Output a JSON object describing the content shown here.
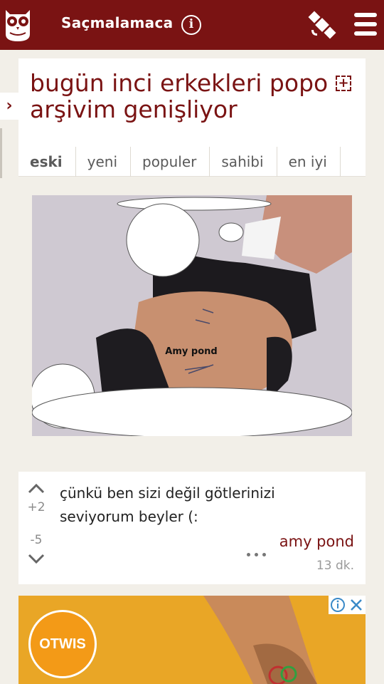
{
  "header": {
    "site_name": "Saçmalamaca",
    "info_label": "i"
  },
  "topic": {
    "title": "bugün inci erkekleri popo arşivim genişliyor",
    "follow_label": "+",
    "tabs": [
      "eski",
      "yeni",
      "populer",
      "sahibi",
      "en iyi"
    ],
    "active_tab": "eski"
  },
  "image": {
    "caption": "Amy pond"
  },
  "entry": {
    "text": "çünkü ben sizi değil götlerinizi seviyorum beyler (:",
    "upvotes": "+2",
    "downvotes": "-5",
    "author": "amy pond",
    "time": "13 dk."
  },
  "ad": {
    "brand": "OTWIS"
  },
  "colors": {
    "brand": "#7a1313",
    "background": "#f2efe8",
    "ad": "#e8a520"
  }
}
